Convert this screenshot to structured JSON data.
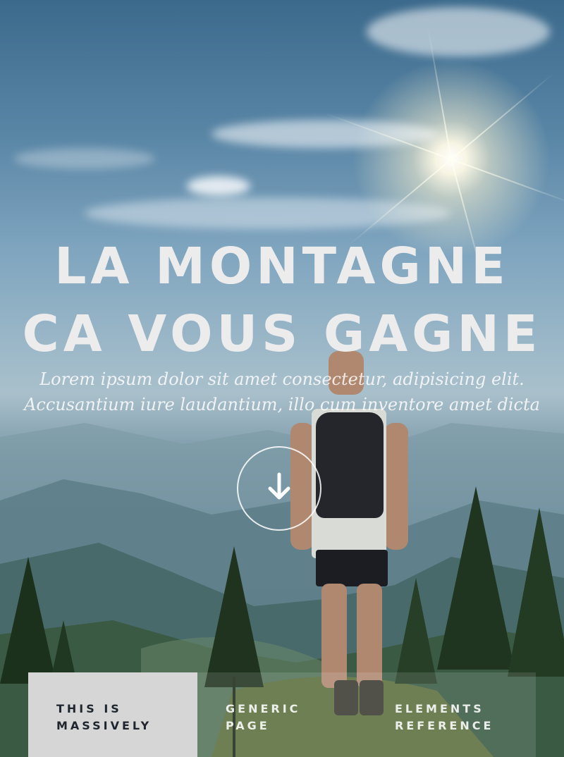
{
  "hero": {
    "title_line1": "LA MONTAGNE",
    "title_line2": "CA VOUS GAGNE",
    "subtitle": "Lorem ipsum dolor sit amet consectetur, adipisicing elit. Accusantium iure laudantium, illo cum inventore amet dicta",
    "scroll_icon": "arrow-down-icon",
    "background_image": "hiker-on-mountain-with-sun"
  },
  "nav": {
    "items": [
      {
        "label": "THIS IS MASSIVELY",
        "active": true
      },
      {
        "label": "GENERIC PAGE",
        "active": false
      },
      {
        "label": "ELEMENTS REFERENCE",
        "active": false
      }
    ]
  },
  "colors": {
    "title_text": "#ececec",
    "nav_active_bg": "#d6d6d6",
    "nav_active_text": "#1e252d"
  }
}
